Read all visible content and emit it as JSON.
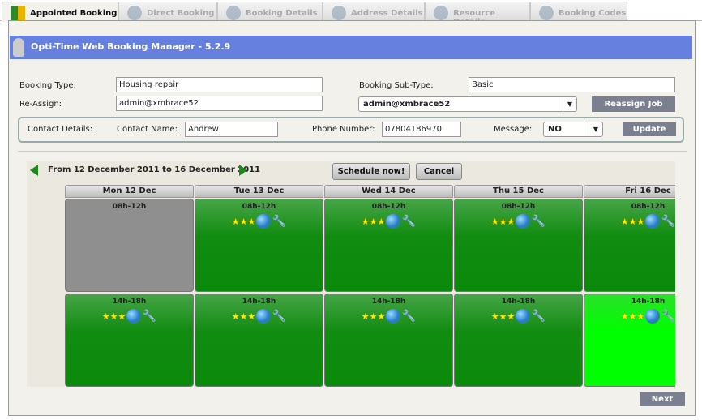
{
  "tabs": [
    {
      "label": "Appointed Booking",
      "icon": "grid-icon",
      "active": true
    },
    {
      "label": "Direct Booking",
      "icon": "clock-icon"
    },
    {
      "label": "Booking Details",
      "icon": "robot-icon"
    },
    {
      "label": "Address Details",
      "icon": "globe-pin-icon"
    },
    {
      "label": "Resource Details",
      "icon": "people-icon"
    },
    {
      "label": "Booking Codes",
      "icon": "bottle-icon"
    }
  ],
  "header": {
    "title": "Opti-Time Web Booking Manager - 5.2.9"
  },
  "form": {
    "booking_type_label": "Booking Type:",
    "booking_type": "Housing repair",
    "sub_type_label": "Booking Sub-Type:",
    "sub_type": "Basic",
    "reassign_label": "Re-Assign:",
    "reassign": "admin@xmbrace52",
    "reassign_select": "admin@xmbrace52",
    "reassign_button": "Reassign Job"
  },
  "contact": {
    "label": "Contact Details:",
    "name_label": "Contact Name:",
    "name": "Andrew",
    "phone_label": "Phone Number:",
    "phone": "07804186970",
    "message_label": "Message:",
    "message": "NO",
    "update_button": "Update"
  },
  "calendar": {
    "range": "From 12 December 2011 to 16 December 2011",
    "schedule_button": "Schedule now!",
    "cancel_button": "Cancel",
    "days": [
      {
        "label": "Mon 12 Dec",
        "slots": [
          {
            "time": "08h-12h",
            "status": "unavailable"
          },
          {
            "time": "14h-18h",
            "status": "available"
          }
        ]
      },
      {
        "label": "Tue 13 Dec",
        "slots": [
          {
            "time": "08h-12h",
            "status": "available"
          },
          {
            "time": "14h-18h",
            "status": "available"
          }
        ]
      },
      {
        "label": "Wed 14 Dec",
        "slots": [
          {
            "time": "08h-12h",
            "status": "available"
          },
          {
            "time": "14h-18h",
            "status": "available"
          }
        ]
      },
      {
        "label": "Thu 15 Dec",
        "slots": [
          {
            "time": "08h-12h",
            "status": "available"
          },
          {
            "time": "14h-18h",
            "status": "available"
          }
        ]
      },
      {
        "label": "Fri 16 Dec",
        "slots": [
          {
            "time": "08h-12h",
            "status": "available"
          },
          {
            "time": "14h-18h",
            "status": "selected"
          }
        ]
      }
    ]
  },
  "next_button": "Next"
}
